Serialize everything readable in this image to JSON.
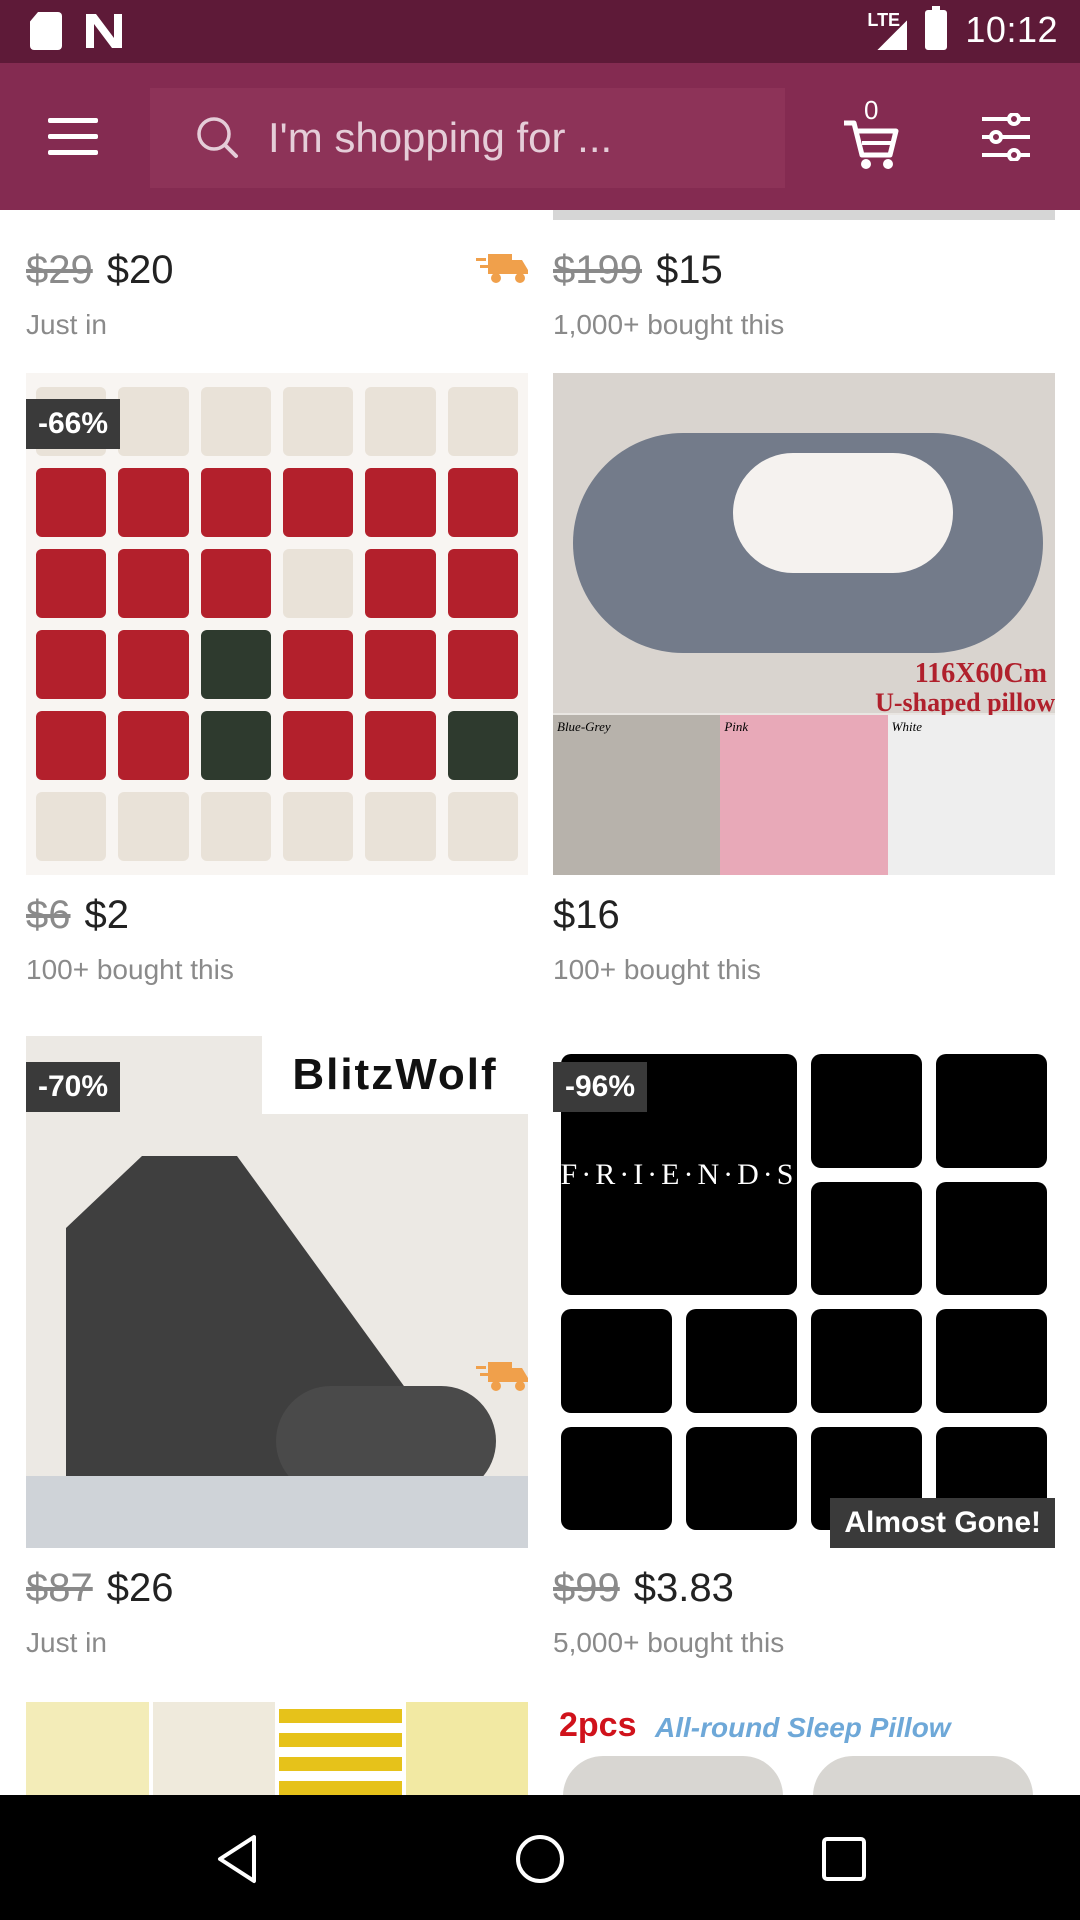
{
  "status_bar": {
    "network": "LTE",
    "time": "10:12"
  },
  "search": {
    "placeholder": "I'm shopping for ..."
  },
  "cart": {
    "count": "0"
  },
  "products": [
    {
      "old_price": "$29",
      "new_price": "$20",
      "meta": "Just in",
      "shipping_icon": "truck-icon"
    },
    {
      "old_price": "$199",
      "new_price": "$15",
      "meta": "1,000+ bought this"
    },
    {
      "badge": "-66%",
      "old_price": "$6",
      "new_price": "$2",
      "meta": "100+ bought this"
    },
    {
      "image_text_1": "116X60Cm",
      "image_text_2": "U-shaped pillow",
      "color_labels": [
        "Blue-Grey",
        "Pink",
        "White"
      ],
      "new_price": "$16",
      "meta": "100+ bought this"
    },
    {
      "badge": "-70%",
      "brand_logo": "BlitzWolf",
      "old_price": "$87",
      "new_price": "$26",
      "meta": "Just in",
      "shipping_icon": "truck-icon"
    },
    {
      "badge": "-96%",
      "status": "Almost Gone!",
      "image_text": "F·R·I·E·N·D·S",
      "old_price": "$99",
      "new_price": "$3.83",
      "meta": "5,000+ bought this"
    },
    {
      "image_text_1": "2pcs",
      "image_text_2": "All-round Sleep Pillow"
    }
  ],
  "colors": {
    "status_bar": "#5e1a38",
    "app_bar": "#842b51",
    "search_bg": "#8d3358",
    "badge": "#3a3a3a",
    "truck": "#f0a04b"
  }
}
